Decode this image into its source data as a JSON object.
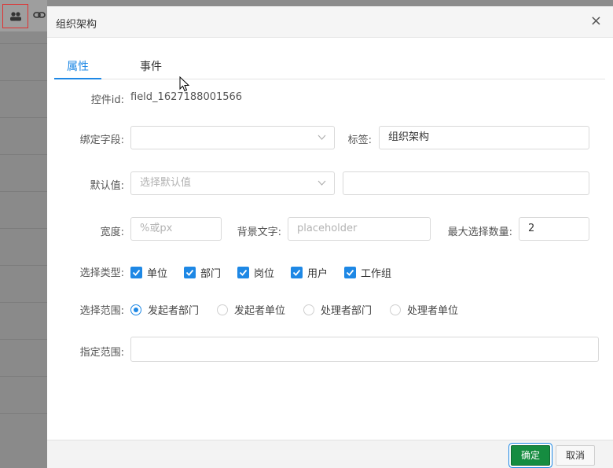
{
  "dialog": {
    "title": "组织架构",
    "close_glyph": "×",
    "tabs": [
      {
        "label": "属性",
        "active": true
      },
      {
        "label": "事件",
        "active": false
      }
    ]
  },
  "form": {
    "control_id_label": "控件id:",
    "control_id_value": "field_1627188001566",
    "bind_field_label": "绑定字段:",
    "bind_field_value": "",
    "tag_label": "标签:",
    "tag_value": "组织架构",
    "default_label": "默认值:",
    "default_placeholder": "选择默认值",
    "default_extra_value": "",
    "width_label": "宽度:",
    "width_placeholder": "%或px",
    "bg_text_label": "背景文字:",
    "bg_text_placeholder": "placeholder",
    "max_select_label": "最大选择数量:",
    "max_select_value": "2",
    "select_type_label": "选择类型:",
    "select_types": [
      {
        "label": "单位",
        "checked": true
      },
      {
        "label": "部门",
        "checked": true
      },
      {
        "label": "岗位",
        "checked": true
      },
      {
        "label": "用户",
        "checked": true
      },
      {
        "label": "工作组",
        "checked": true
      }
    ],
    "select_range_label": "选择范围:",
    "select_ranges": [
      {
        "label": "发起者部门",
        "selected": true
      },
      {
        "label": "发起者单位",
        "selected": false
      },
      {
        "label": "处理者部门",
        "selected": false
      },
      {
        "label": "处理者单位",
        "selected": false
      }
    ],
    "specify_range_label": "指定范围:",
    "specify_range_value": ""
  },
  "footer": {
    "ok_label": "确定",
    "cancel_label": "取消"
  },
  "icons": {
    "org": "org-chart-icon",
    "link": "link-icon",
    "dropdown": "chevron-down-icon",
    "check": "check-icon"
  },
  "colors": {
    "accent": "#1e88e5",
    "ok_button": "#158c40",
    "highlight_border": "#e03030"
  }
}
